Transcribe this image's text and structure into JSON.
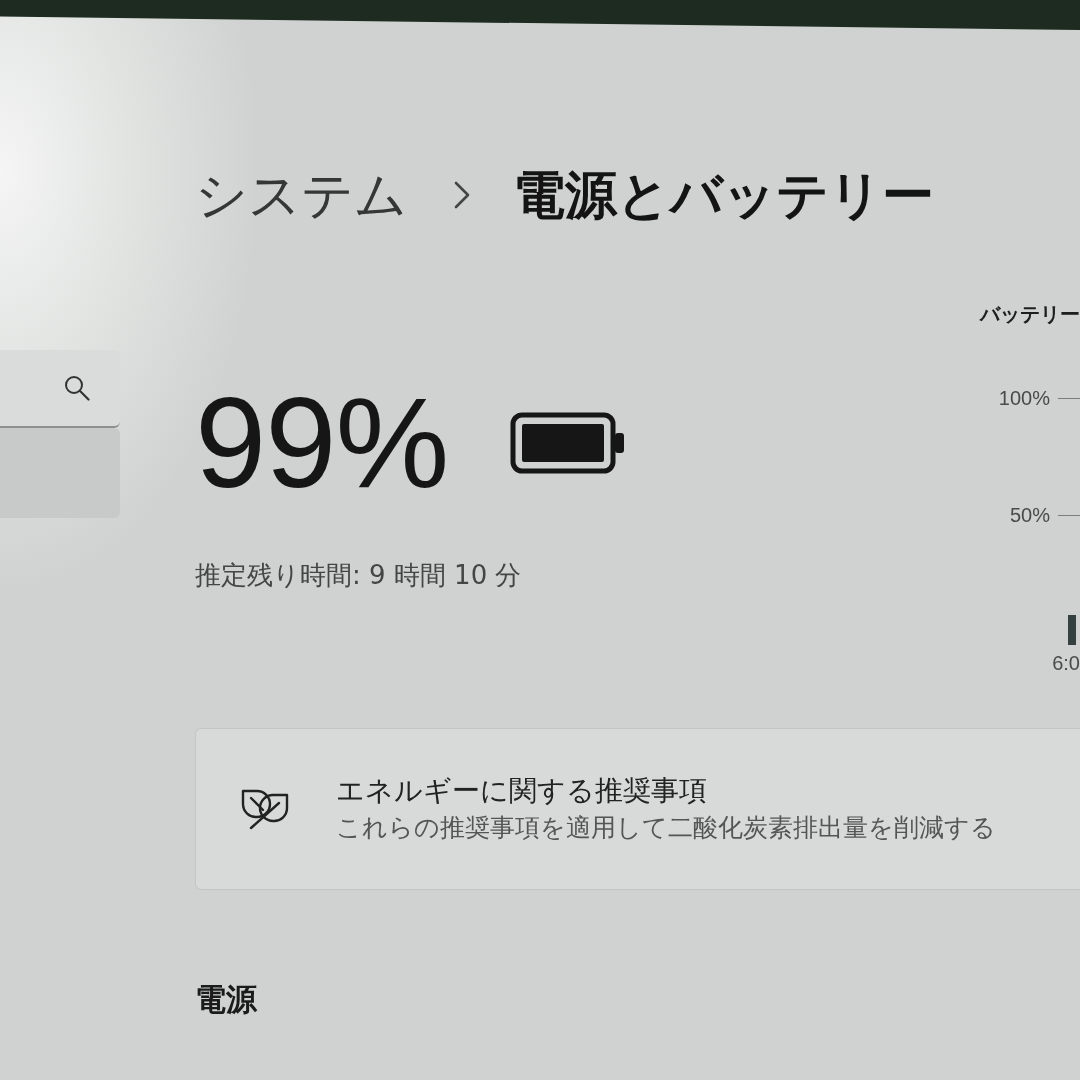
{
  "sidebar": {
    "items": [
      {
        "selected": true
      }
    ]
  },
  "breadcrumb": {
    "parent": "システム",
    "current": "電源とバッテリー"
  },
  "battery": {
    "percentage": "99%",
    "estimate": "推定残り時間: 9 時間 10 分"
  },
  "usage_chart": {
    "title": "バッテリー",
    "y_labels": [
      "100%",
      "50%"
    ],
    "x_labels": [
      "6:0"
    ]
  },
  "recommendation_card": {
    "title": "エネルギーに関する推奨事項",
    "description": "これらの推奨事項を適用して二酸化炭素排出量を削減する"
  },
  "sections": [
    {
      "heading": "電源"
    }
  ]
}
